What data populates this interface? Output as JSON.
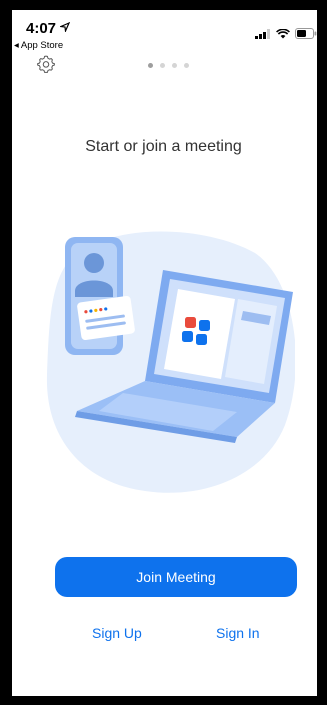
{
  "status_bar": {
    "time": "4:07",
    "back_label": "◂ App Store"
  },
  "header": {
    "settings_icon": "gear-icon",
    "page_dots": 4,
    "active_page": 1
  },
  "main": {
    "headline": "Start or join a meeting"
  },
  "actions": {
    "join_label": "Join Meeting",
    "signup_label": "Sign Up",
    "signin_label": "Sign In"
  },
  "colors": {
    "accent": "#0e72ed",
    "illustration_bg": "#e6effc"
  }
}
